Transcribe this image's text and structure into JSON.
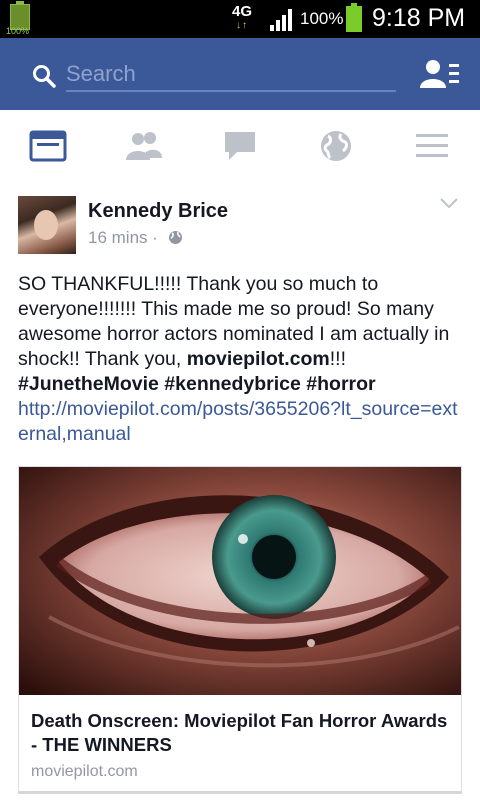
{
  "status_bar": {
    "left_battery_pct": "100%",
    "network": "4G",
    "battery_pct": "100%",
    "time": "9:18 PM"
  },
  "header": {
    "search_placeholder": "Search",
    "icons": [
      "search-icon",
      "friend-requests-icon"
    ],
    "brand_color": "#3b5998"
  },
  "tabs": [
    {
      "name": "news-feed",
      "icon": "news-feed-icon",
      "active": true
    },
    {
      "name": "friends",
      "icon": "friends-icon",
      "active": false
    },
    {
      "name": "messages",
      "icon": "chat-bubble-icon",
      "active": false
    },
    {
      "name": "notifications",
      "icon": "globe-icon",
      "active": false
    },
    {
      "name": "more",
      "icon": "menu-icon",
      "active": false
    }
  ],
  "post": {
    "author": "Kennedy Brice",
    "time": "16 mins",
    "separator": "·",
    "text_plain_1": "SO THANKFUL!!!!! Thank you so much to everyone!!!!!!! This made me so proud! So many awesome horror actors nominated I am actually in shock!! Thank you, ",
    "text_bold_1": "moviepilot.com",
    "text_plain_2": "!!! ",
    "hashtags": [
      "#JunetheMovie",
      "#kennedybrice",
      "#horror"
    ],
    "url": "http://moviepilot.com/posts/3655206?lt_source=external,manual",
    "link_preview": {
      "title": "Death Onscreen: Moviepilot Fan Horror Awards - THE WINNERS",
      "domain": "moviepilot.com"
    }
  }
}
